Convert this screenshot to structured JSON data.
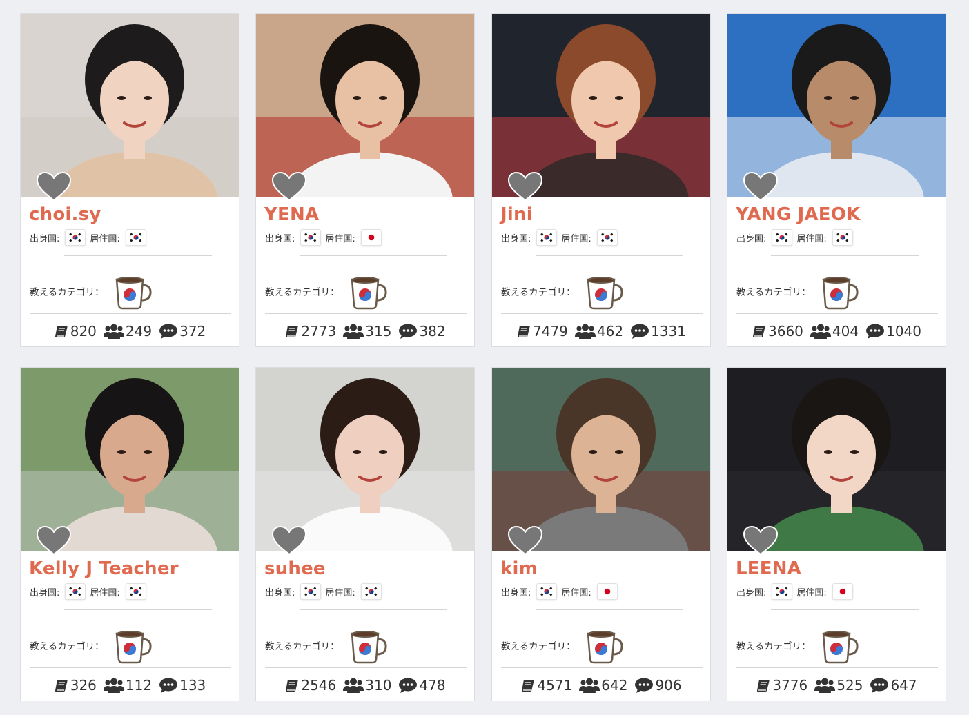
{
  "labels": {
    "origin": "出身国:",
    "residence": "居住国:",
    "category": "教えるカテゴリ："
  },
  "icons": {
    "favorite": "heart-icon",
    "lessons": "book-icon",
    "students": "users-icon",
    "reviews": "comment-icon",
    "category": "korean-coffee-cup-icon"
  },
  "colors": {
    "name": "#e06a50",
    "heart": "#777777",
    "background": "#eeeff2"
  },
  "teachers": [
    {
      "name": "choi.sy",
      "origin": "korea",
      "residence": "korea",
      "lessons": "820",
      "students": "249",
      "reviews": "372"
    },
    {
      "name": "YENA",
      "origin": "korea",
      "residence": "japan",
      "lessons": "2773",
      "students": "315",
      "reviews": "382"
    },
    {
      "name": "Jini",
      "origin": "korea",
      "residence": "korea",
      "lessons": "7479",
      "students": "462",
      "reviews": "1331"
    },
    {
      "name": "YANG JAEOK",
      "origin": "korea",
      "residence": "korea",
      "lessons": "3660",
      "students": "404",
      "reviews": "1040"
    },
    {
      "name": "Kelly J Teacher",
      "origin": "korea",
      "residence": "korea",
      "lessons": "326",
      "students": "112",
      "reviews": "133"
    },
    {
      "name": "suhee",
      "origin": "korea",
      "residence": "korea",
      "lessons": "2546",
      "students": "310",
      "reviews": "478"
    },
    {
      "name": "kim",
      "origin": "korea",
      "residence": "japan",
      "lessons": "4571",
      "students": "642",
      "reviews": "906"
    },
    {
      "name": "LEENA",
      "origin": "korea",
      "residence": "japan",
      "lessons": "3776",
      "students": "525",
      "reviews": "647"
    }
  ]
}
